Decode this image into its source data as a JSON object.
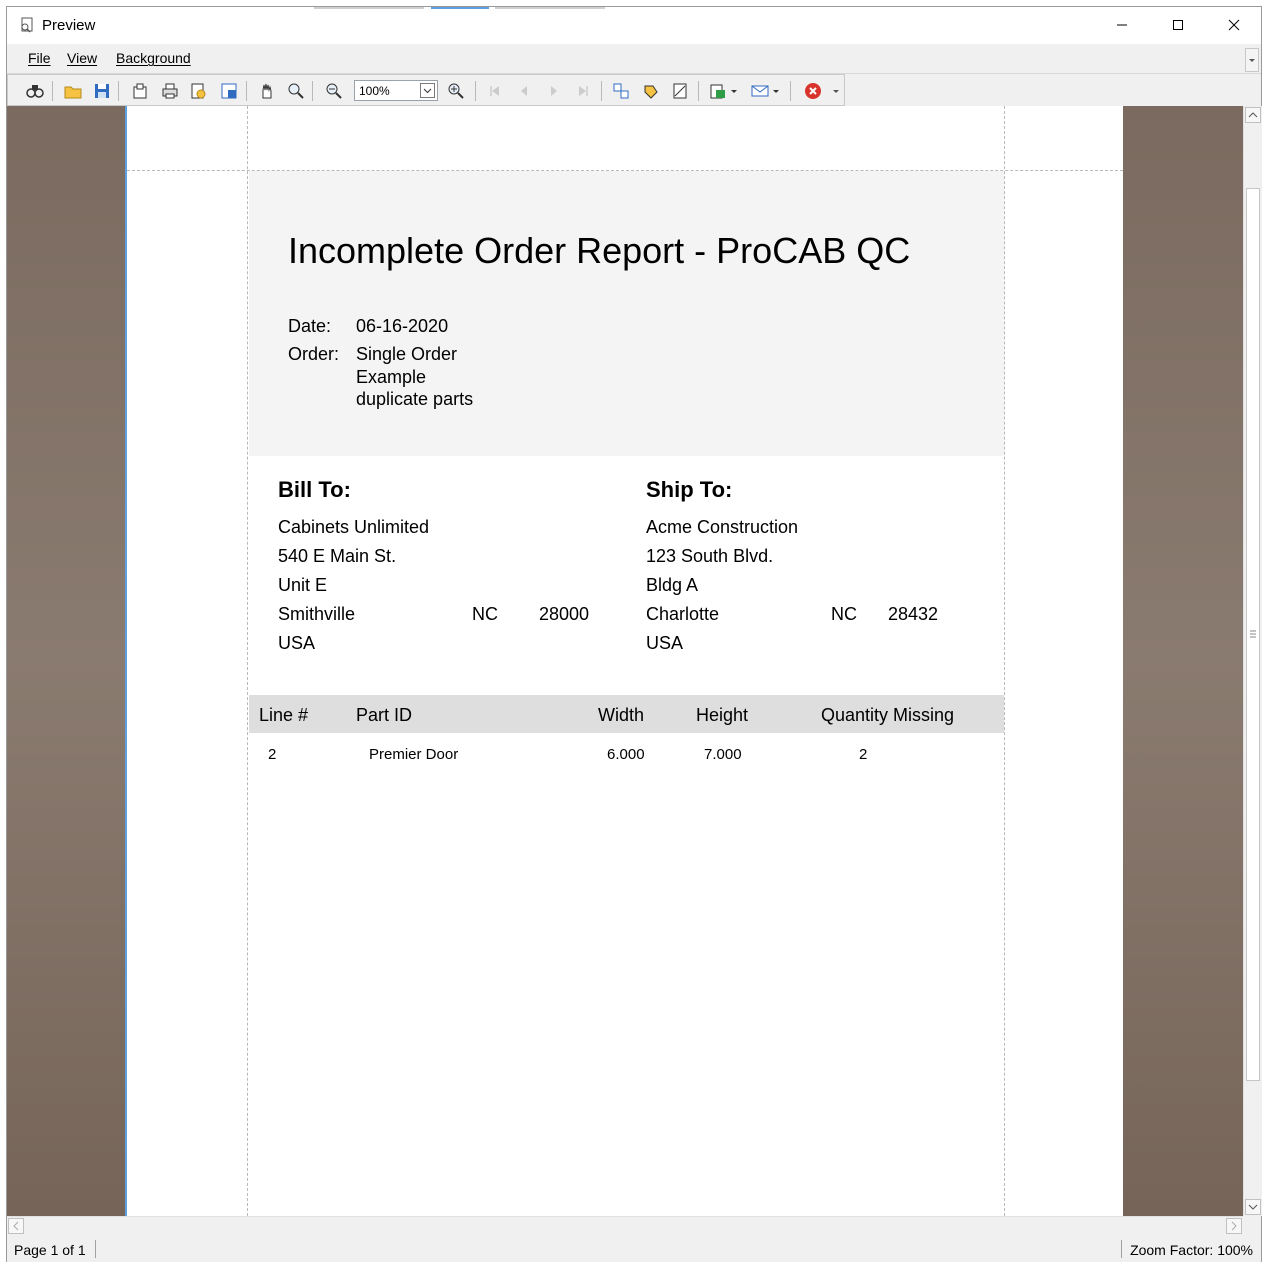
{
  "window": {
    "title": "Preview"
  },
  "menu": {
    "file": "File",
    "view": "View",
    "background": "Background"
  },
  "toolbar": {
    "zoom_value": "100%",
    "icons": [
      "find-icon",
      "open-icon",
      "save-icon",
      "page-setup-icon",
      "print-icon",
      "print-preview-icon",
      "scale-icon",
      "hand-tool-icon",
      "magnifier-icon",
      "zoom-out-icon",
      "zoom-in-icon",
      "first-page-icon",
      "previous-page-icon",
      "next-page-icon",
      "last-page-icon",
      "multiple-pages-icon",
      "color-icon",
      "watermark-icon",
      "export-icon",
      "email-icon",
      "close-preview-icon"
    ]
  },
  "report": {
    "title": "Incomplete Order Report - ProCAB QC",
    "date_label": "Date:",
    "date_value": "06-16-2020",
    "order_label": "Order:",
    "order_value": "Single Order Example duplicate parts",
    "bill_to": {
      "heading": "Bill To:",
      "name": "Cabinets Unlimited",
      "address1": "540 E Main St.",
      "address2": "Unit E",
      "city": "Smithville",
      "state": "NC",
      "zip": "28000",
      "country": "USA"
    },
    "ship_to": {
      "heading": "Ship To:",
      "name": "Acme Construction",
      "address1": "123 South Blvd.",
      "address2": "Bldg A",
      "city": "Charlotte",
      "state": "NC",
      "zip": "28432",
      "country": "USA"
    },
    "table": {
      "headers": [
        "Line #",
        "Part ID",
        "Width",
        "Height",
        "Quantity Missing"
      ],
      "rows": [
        {
          "line": "2",
          "part_id": "Premier Door",
          "width": "6.000",
          "height": "7.000",
          "qty_missing": "2"
        }
      ]
    }
  },
  "status": {
    "page": "Page 1 of 1",
    "zoom": "Zoom Factor: 100%"
  }
}
